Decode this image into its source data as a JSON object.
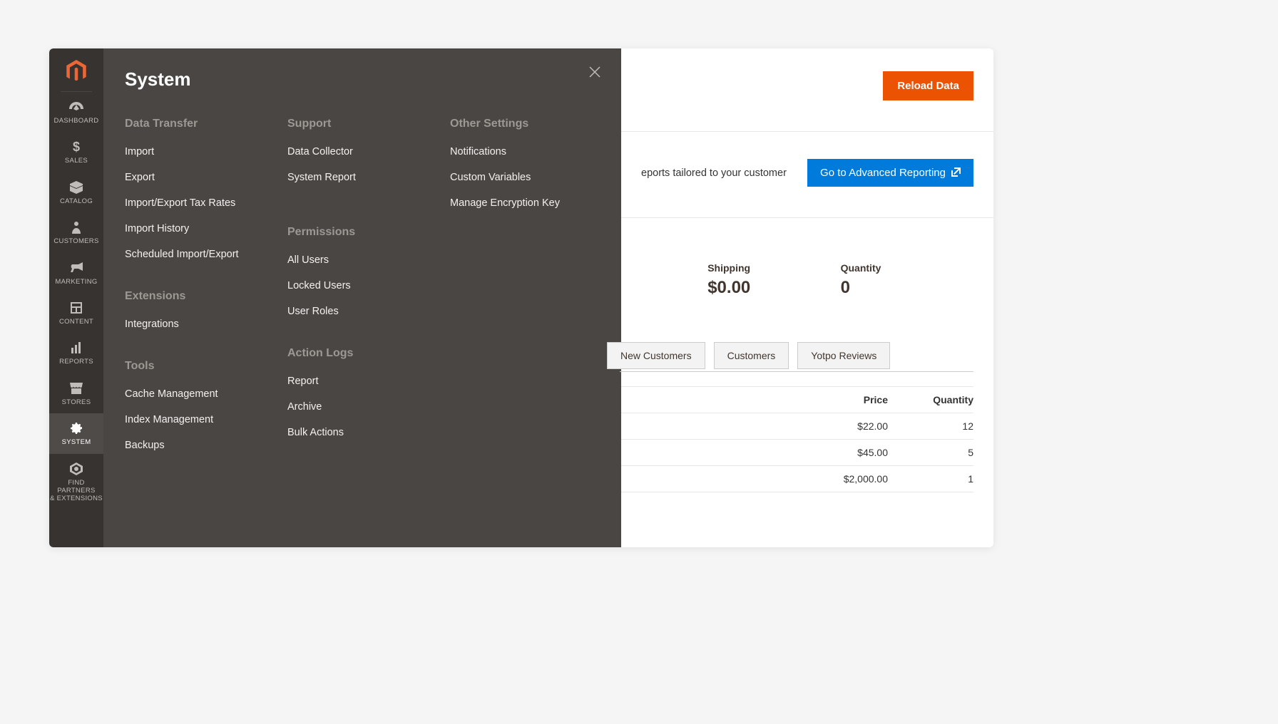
{
  "sidebar": {
    "items": [
      {
        "label": "DASHBOARD"
      },
      {
        "label": "SALES"
      },
      {
        "label": "CATALOG"
      },
      {
        "label": "CUSTOMERS"
      },
      {
        "label": "MARKETING"
      },
      {
        "label": "CONTENT"
      },
      {
        "label": "REPORTS"
      },
      {
        "label": "STORES"
      },
      {
        "label": "SYSTEM"
      },
      {
        "label": "FIND PARTNERS\n& EXTENSIONS"
      }
    ]
  },
  "flyout": {
    "title": "System",
    "columns": [
      {
        "groups": [
          {
            "title": "Data Transfer",
            "links": [
              "Import",
              "Export",
              "Import/Export Tax Rates",
              "Import History",
              "Scheduled Import/Export"
            ]
          },
          {
            "title": "Extensions",
            "links": [
              "Integrations"
            ]
          },
          {
            "title": "Tools",
            "links": [
              "Cache Management",
              "Index Management",
              "Backups"
            ]
          }
        ]
      },
      {
        "groups": [
          {
            "title": "Support",
            "links": [
              "Data Collector",
              "System Report"
            ]
          },
          {
            "title": "Permissions",
            "links": [
              "All Users",
              "Locked Users",
              "User Roles"
            ]
          },
          {
            "title": "Action Logs",
            "links": [
              "Report",
              "Archive",
              "Bulk Actions"
            ]
          }
        ]
      },
      {
        "groups": [
          {
            "title": "Other Settings",
            "links": [
              "Notifications",
              "Custom Variables",
              "Manage Encryption Key"
            ]
          }
        ]
      }
    ]
  },
  "main": {
    "reload_label": "Reload Data",
    "ad_text": "eports tailored to your customer",
    "ad_button": "Go to Advanced Reporting",
    "stats": {
      "shipping_label": "Shipping",
      "shipping_value": "$0.00",
      "quantity_label": "Quantity",
      "quantity_value": "0"
    },
    "tabs": [
      "New Customers",
      "Customers",
      "Yotpo Reviews"
    ],
    "table": {
      "headers": {
        "price": "Price",
        "qty": "Quantity"
      },
      "rows": [
        {
          "price": "$22.00",
          "qty": "12"
        },
        {
          "price": "$45.00",
          "qty": "5"
        },
        {
          "price": "$2,000.00",
          "qty": "1"
        }
      ]
    }
  }
}
